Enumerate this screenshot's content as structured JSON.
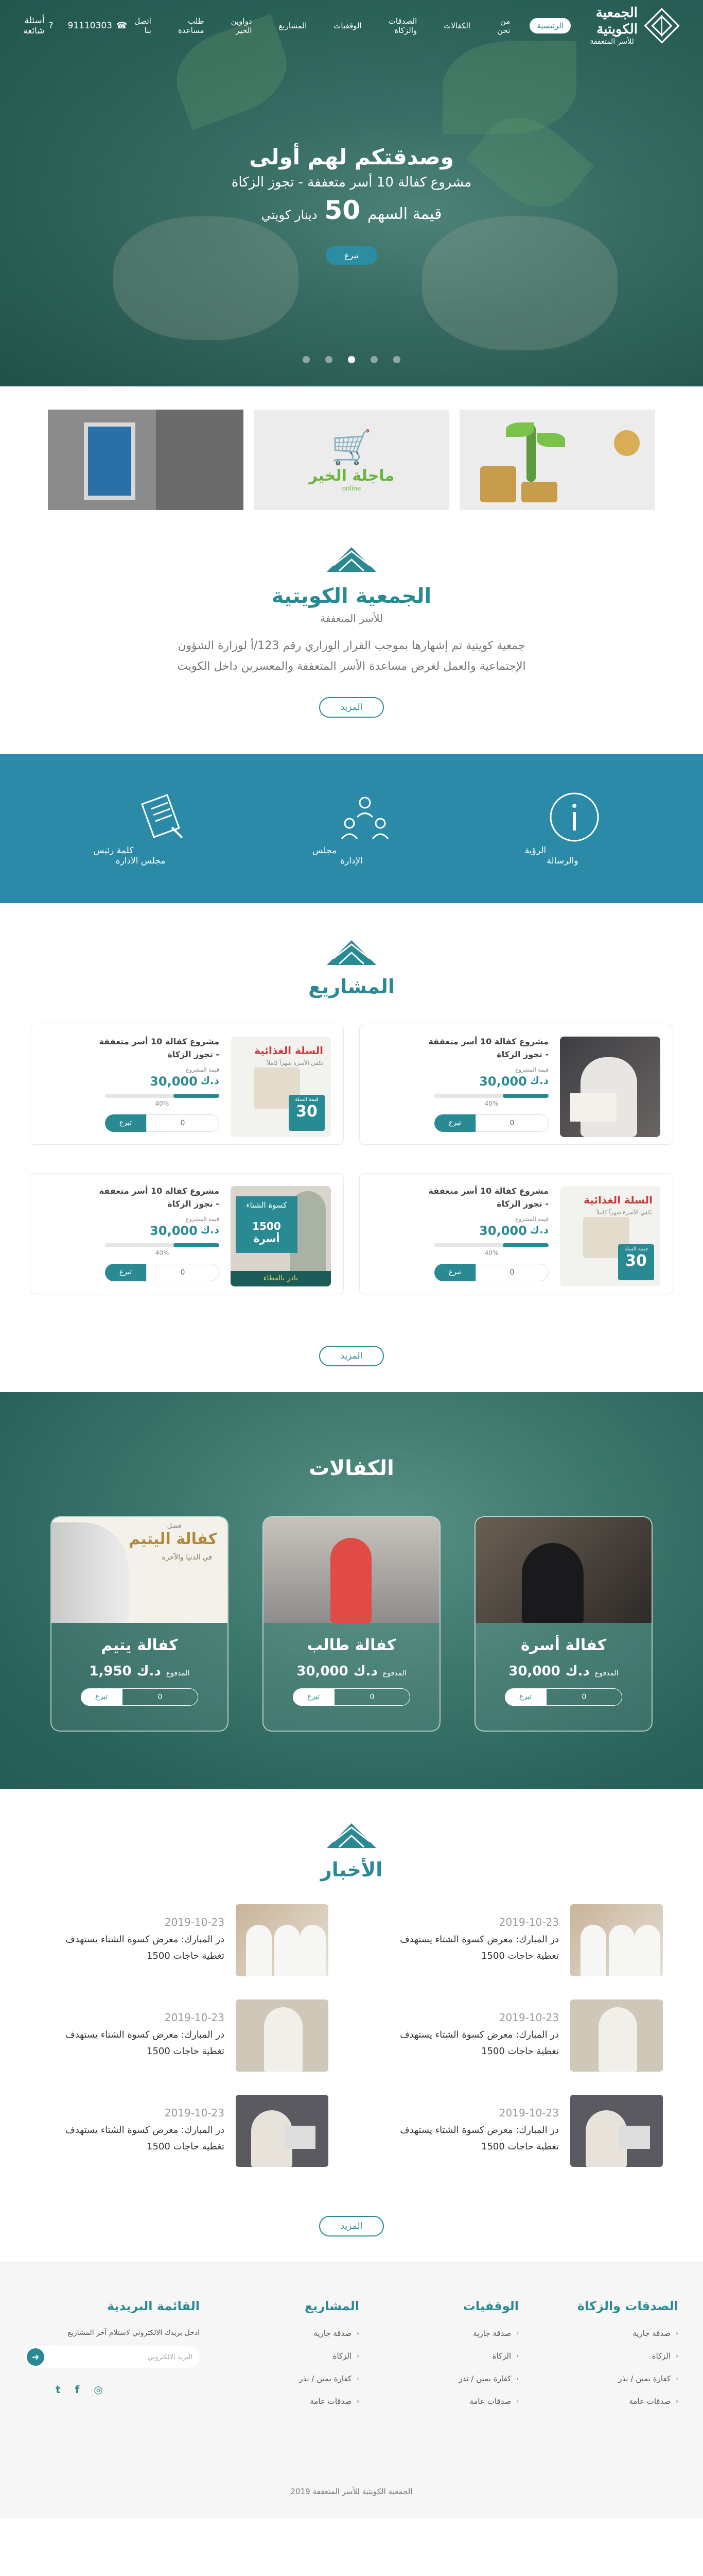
{
  "header": {
    "logo_title": "الجمعية الكويتية",
    "logo_subtitle": "للأسر المتعففة",
    "nav": [
      "الرئيسية",
      "من نحن",
      "الكفالات",
      "الصدقات والزكاة",
      "الوقفيات",
      "المشاريع",
      "دواوين الخير",
      "طلب مساعدة",
      "اتصل بنا"
    ],
    "phone": "91110303",
    "faq": "أسئلة شائعة"
  },
  "hero": {
    "title": "وصدقتكم لهم أولى",
    "subtitle": "مشروع كفالة 10 أسر متعففة - تجوز الزكاة",
    "price_label": "قيمة السهم",
    "price_value": "50",
    "price_currency": "دينار كويتي",
    "button": "تبرع",
    "slides": 5,
    "active_slide": 3
  },
  "banners": {
    "cart_title": "ماجلة الخير",
    "cart_sub": "online"
  },
  "about": {
    "title": "الجمعية الكويتية",
    "tagline": "للأسر المتعففة",
    "text": "جمعية كويتية تم إشهارها بموجب القرار الوزاري رقم 123/أ لوزارة الشؤون الإجتماعية والعمل لغرض مساعدة الأسر المتعففة والمعسرين داخل الكويت",
    "more": "المزيد"
  },
  "strip": [
    {
      "label": "الرؤية والرسالة",
      "icon": "info-icon"
    },
    {
      "label": "مجلس الإدارة",
      "icon": "team-icon"
    },
    {
      "label": "كلمة رئيس مجلس الادارة",
      "icon": "document-icon"
    }
  ],
  "projects": {
    "title": "المشاريع",
    "more": "المزيد",
    "items": [
      {
        "title": "مشروع كفالة 10 أسر متعففة",
        "subtitle": "- تجوز الزكاة",
        "label": "قيمة المشروع",
        "amount": "30,000",
        "currency": "د.ك",
        "progress": 40,
        "progress_text": "40%",
        "input": "0",
        "button": "تبرع",
        "image": "old"
      },
      {
        "title": "مشروع كفالة 10 أسر متعففة",
        "subtitle": "- تجوز الزكاة",
        "label": "قيمة المشروع",
        "amount": "30,000",
        "currency": "د.ك",
        "progress": 40,
        "progress_text": "40%",
        "input": "0",
        "button": "تبرع",
        "image": "food"
      },
      {
        "title": "مشروع كفالة 10 أسر متعففة",
        "subtitle": "- تجوز الزكاة",
        "label": "قيمة المشروع",
        "amount": "30,000",
        "currency": "د.ك",
        "progress": 40,
        "progress_text": "40%",
        "input": "0",
        "button": "تبرع",
        "image": "food"
      },
      {
        "title": "مشروع كفالة 10 أسر متعففة",
        "subtitle": "- تجوز الزكاة",
        "label": "قيمة المشروع",
        "amount": "30,000",
        "currency": "د.ك",
        "progress": 40,
        "progress_text": "40%",
        "input": "0",
        "button": "تبرع",
        "image": "winter"
      }
    ],
    "food_title": "السلة الغذائية",
    "food_sub": "تكفي الأسرة شهراً كاملاً",
    "food_badge_label": "قيمة السلة",
    "food_badge_value": "30",
    "winter_title": "كسوة الشتاء",
    "winter_value": "1500 أسرة",
    "winter_bar": "بادر بالعطاء"
  },
  "sponsorships": {
    "title": "الكفالات",
    "items": [
      {
        "title": "كفالة أسرة",
        "label": "المدفوع",
        "value": "30,000",
        "currency": "د.ك",
        "input": "0",
        "button": "تبرع",
        "image": "fam"
      },
      {
        "title": "كفالة طالب",
        "label": "المدفوع",
        "value": "30,000",
        "currency": "د.ك",
        "input": "0",
        "button": "تبرع",
        "image": "stu"
      },
      {
        "title": "كفالة يتيم",
        "label": "المدفوع",
        "value": "1,950",
        "currency": "د.ك",
        "input": "0",
        "button": "تبرع",
        "image": "orp"
      }
    ],
    "orphan_img_title": "كفالة اليتيم",
    "orphan_img_sub": "في الدنيا والآخرة",
    "orphan_img_top": "فضل"
  },
  "news": {
    "title": "الأخبار",
    "more": "المزيد",
    "items": [
      {
        "date": "2019-10-23",
        "title": "در المبارك: معرض كسوة الشتاء يستهدف تغطية حاجات 1500",
        "image": "g1"
      },
      {
        "date": "2019-10-23",
        "title": "در المبارك: معرض كسوة الشتاء يستهدف تغطية حاجات 1500",
        "image": "g1"
      },
      {
        "date": "2019-10-23",
        "title": "در المبارك: معرض كسوة الشتاء يستهدف تغطية حاجات 1500",
        "image": "g2"
      },
      {
        "date": "2019-10-23",
        "title": "در المبارك: معرض كسوة الشتاء يستهدف تغطية حاجات 1500",
        "image": "g2"
      },
      {
        "date": "2019-10-23",
        "title": "در المبارك: معرض كسوة الشتاء يستهدف تغطية حاجات 1500",
        "image": "g3"
      },
      {
        "date": "2019-10-23",
        "title": "در المبارك: معرض كسوة الشتاء يستهدف تغطية حاجات 1500",
        "image": "g3"
      }
    ]
  },
  "footer": {
    "cols": [
      {
        "title": "الصدقات والزكاة",
        "items": [
          "صدقة جارية",
          "الزكاة",
          "كفارة يمين / نذر",
          "صدقات عامة"
        ]
      },
      {
        "title": "الوقفيات",
        "items": [
          "صدقة جارية",
          "الزكاة",
          "كفارة يمين / نذر",
          "صدقات عامة"
        ]
      },
      {
        "title": "المشاريع",
        "items": [
          "صدقة جارية",
          "الزكاة",
          "كفارة يمين / نذر",
          "صدقات عامة"
        ]
      }
    ],
    "newsletter_title": "القائمة البريدية",
    "newsletter_text": "ادخل بريدك الالكتروني لاستلام آخر المشاريع",
    "newsletter_placeholder": "البريد الالكتروني",
    "copyright": "الجمعية الكويتية للأسر المتعففة 2019"
  },
  "colors": {
    "primary": "#2a8a94",
    "strip": "#2a8aa8"
  }
}
